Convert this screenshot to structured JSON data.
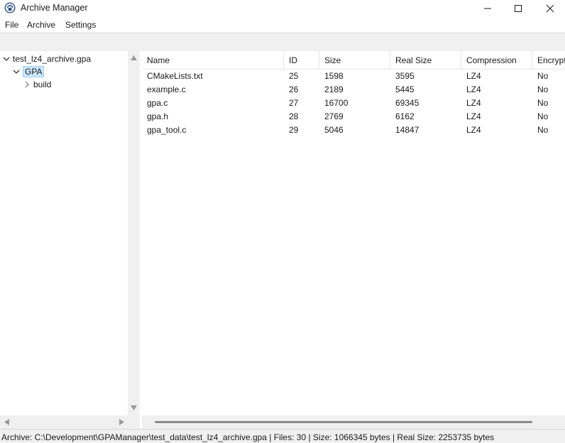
{
  "window": {
    "title": "Archive Manager",
    "icon": "paw-icon"
  },
  "menu": {
    "file": "File",
    "archive": "Archive",
    "settings": "Settings"
  },
  "tree": {
    "root": "test_lz4_archive.gpa",
    "child": "GPA",
    "grandchild": "build"
  },
  "table": {
    "columns": [
      "Name",
      "ID",
      "Size",
      "Real Size",
      "Compression",
      "Encrypted"
    ],
    "rows": [
      [
        "CMakeLists.txt",
        "25",
        "1598",
        "3595",
        "LZ4",
        "No"
      ],
      [
        "example.c",
        "26",
        "2189",
        "5445",
        "LZ4",
        "No"
      ],
      [
        "gpa.c",
        "27",
        "16700",
        "69345",
        "LZ4",
        "No"
      ],
      [
        "gpa.h",
        "28",
        "2769",
        "6162",
        "LZ4",
        "No"
      ],
      [
        "gpa_tool.c",
        "29",
        "5046",
        "14847",
        "LZ4",
        "No"
      ]
    ]
  },
  "status": {
    "text": "Archive: C:\\Development\\GPAManager\\test_data\\test_lz4_archive.gpa | Files: 30 | Size: 1066345 bytes | Real Size: 2253735 bytes"
  },
  "colors": {
    "selection_bg": "#cce8ff",
    "selection_border": "#99d1ff",
    "chrome": "#f0f0f0"
  }
}
